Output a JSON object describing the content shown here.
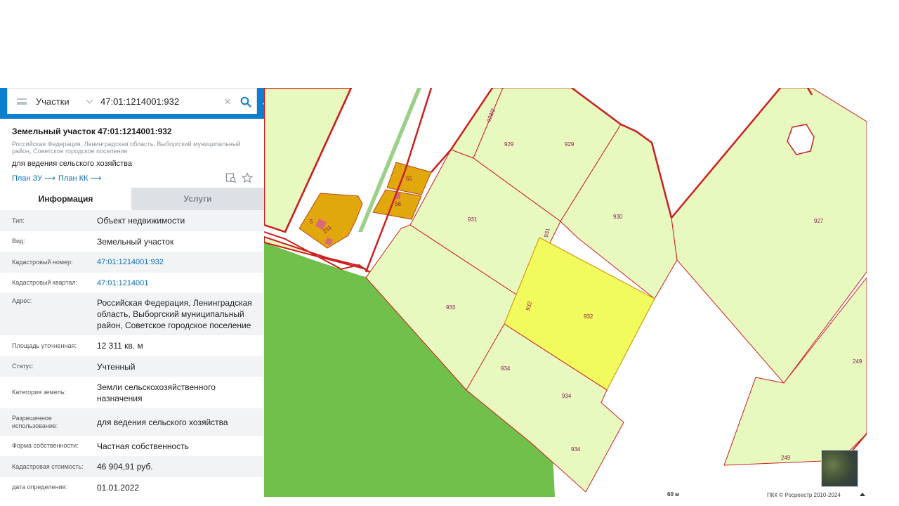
{
  "search": {
    "type": "Участки",
    "value": "47:01:1214001:932"
  },
  "object": {
    "title": "Земельный участок 47:01:1214001:932",
    "address_short": "Российская Федерация, Ленинградская область, Выборгский муниципальный район, Советское городское поселение",
    "purpose": "для ведения сельского хозяйства",
    "plan_zu": "План ЗУ",
    "plan_kk": "План КК"
  },
  "tabs": {
    "info": "Информация",
    "services": "Услуги"
  },
  "rows": [
    {
      "label": "Тип:",
      "value": "Объект недвижимости"
    },
    {
      "label": "Вид:",
      "value": "Земельный участок"
    },
    {
      "label": "Кадастровый номер:",
      "value": "47:01:1214001:932"
    },
    {
      "label": "Кадастровый квартал:",
      "value": "47:01:1214001"
    },
    {
      "label": "Адрес:",
      "value": "Российская Федерация, Ленинградская область, Выборгский муниципальный район, Советское городское поселение"
    },
    {
      "label": "Площадь уточненная:",
      "value": "12 311 кв. м"
    },
    {
      "label": "Статус:",
      "value": "Учтенный"
    },
    {
      "label": "Категория земель:",
      "value": "Земли сельскохозяйственного назначения"
    },
    {
      "label": "Разрешенное использование:",
      "value": "для ведения сельского хозяйства"
    },
    {
      "label": "Форма собственности:",
      "value": "Частная собственность"
    },
    {
      "label": "Кадастровая стоимость:",
      "value": "46 904,91 руб."
    },
    {
      "label": "дата определения:",
      "value": "01.01.2022"
    }
  ],
  "map": {
    "labels": {
      "p928_2": "928/2",
      "p929a": "929",
      "p929b": "929",
      "p927": "927",
      "p55": "55",
      "p56": "56",
      "p5": "5",
      "p231": "231",
      "p931a": "931",
      "p931b": "931",
      "p930": "930",
      "p933": "933",
      "p932a": "932",
      "p932b": "932",
      "p934a": "934",
      "p934b": "934",
      "p934c": "934",
      "p249a": "249",
      "p249b": "249"
    },
    "scale": "60 м",
    "copyright": "ПКК © Росреестр 2010-2024"
  },
  "colors": {
    "accent": "#0d7fd1",
    "parcel_fill": "#e8f9c0",
    "parcel_border": "#cc1f1f",
    "selected_fill": "#f2fb5e",
    "building_fill": "#e0a80c",
    "forest_fill": "#72c04c"
  },
  "icons": {
    "menu": "menu-icon",
    "search": "search-icon",
    "clear": "close-icon",
    "collapse": "chevron-left-icon",
    "print": "print-preview-icon",
    "favorite": "star-icon"
  }
}
